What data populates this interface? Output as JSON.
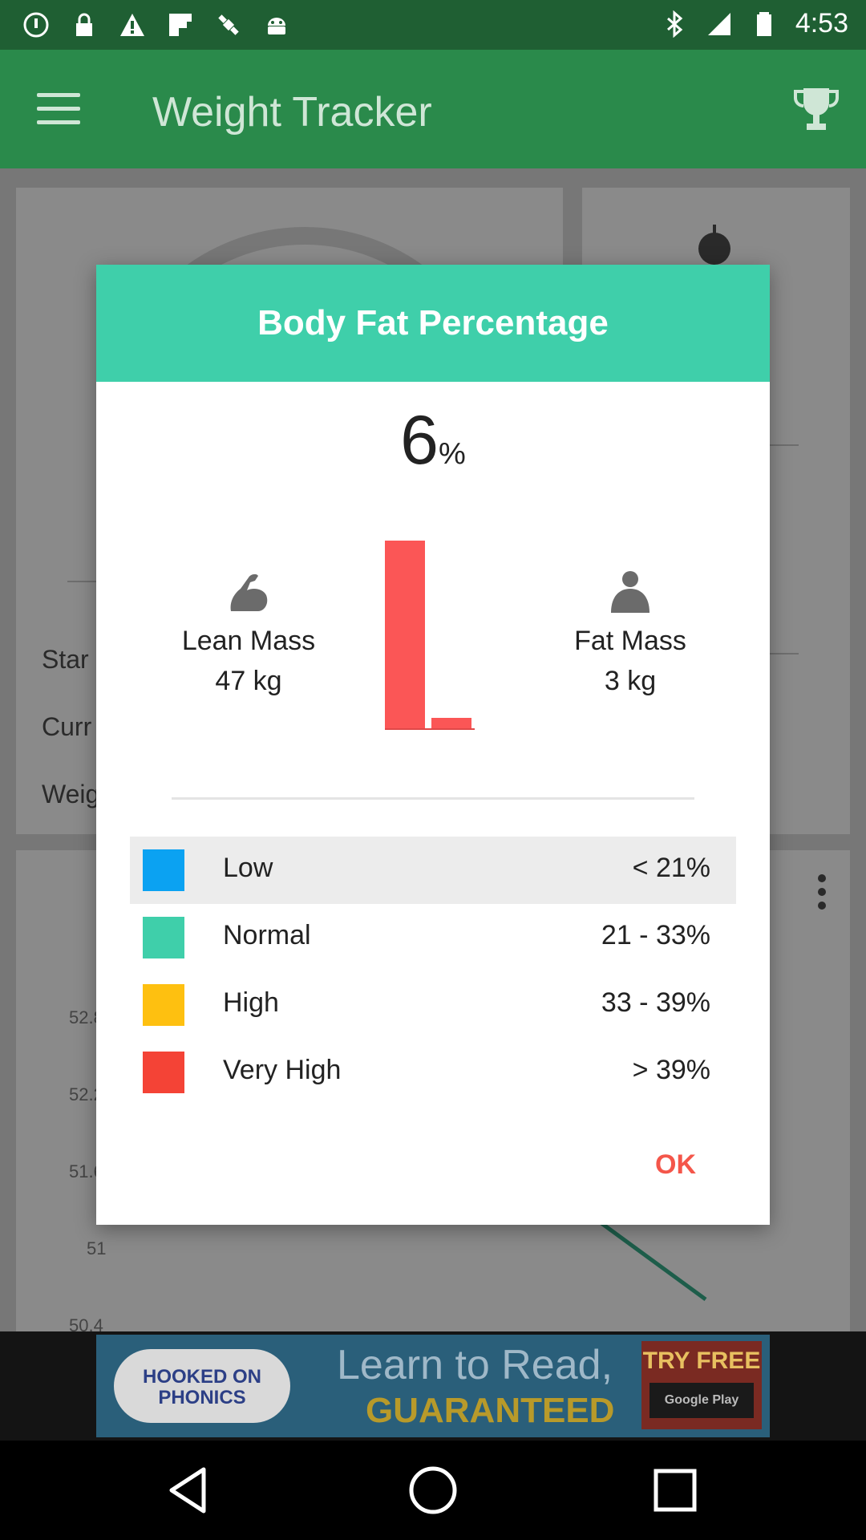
{
  "status_bar": {
    "time": "4:53",
    "icons": [
      "alert-circle-icon",
      "lock-icon",
      "warning-icon",
      "flipboard-icon",
      "fake-gps-icon",
      "android-icon",
      "bluetooth-icon",
      "signal-icon",
      "battery-icon"
    ]
  },
  "app_bar": {
    "title": "Weight Tracker",
    "menu_icon": "hamburger-icon",
    "action_icon": "trophy-icon"
  },
  "background": {
    "rows": [
      "Star",
      "Curr",
      "Weig"
    ],
    "axis_labels": [
      "52.8",
      "52.2",
      "51.6",
      "51",
      "50.4"
    ],
    "fab_label": "+"
  },
  "ad": {
    "logo_line1": "HOOKED ON",
    "logo_line2": "PHONICS",
    "line1": "Learn to Read,",
    "line2": "GUARANTEED",
    "cta_line1": "TRY FREE",
    "cta_line2": "Google Play"
  },
  "dialog": {
    "title": "Body Fat Percentage",
    "percent_value": "6",
    "percent_unit": "%",
    "lean_mass": {
      "label": "Lean Mass",
      "value": "47 kg",
      "icon": "flexed-arm-icon"
    },
    "fat_mass": {
      "label": "Fat Mass",
      "value": "3 kg",
      "icon": "body-icon"
    },
    "bar_chart": {
      "lean_kg": 47,
      "fat_kg": 3,
      "bar_color": "#fb5656"
    },
    "legend": [
      {
        "label": "Low",
        "range": "< 21%",
        "color": "#0ba2f2",
        "selected": true
      },
      {
        "label": "Normal",
        "range": "21 - 33%",
        "color": "#3fcfaa",
        "selected": false
      },
      {
        "label": "High",
        "range": "33 - 39%",
        "color": "#fec010",
        "selected": false
      },
      {
        "label": "Very High",
        "range": "> 39%",
        "color": "#f44336",
        "selected": false
      }
    ],
    "ok_label": "OK"
  },
  "nav_bar": {
    "back_icon": "back-triangle-icon",
    "home_icon": "home-circle-icon",
    "recent_icon": "recent-square-icon"
  }
}
